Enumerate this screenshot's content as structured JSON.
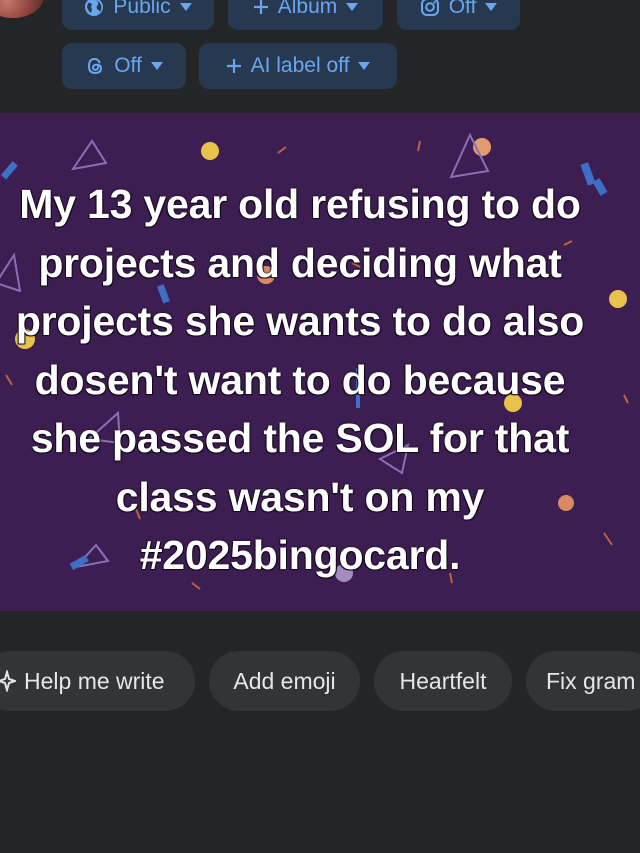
{
  "audience_row": {
    "privacy_label": "Public",
    "album_label": "Album",
    "instagram_label": "Off",
    "threads_label": "Off",
    "ai_label": "AI label off"
  },
  "post": {
    "text": "My 13 year old refusing to do projects and deciding what projects she wants to do also dosen't want to do because she passed the SOL for that class wasn't on my #2025bingocard.",
    "background_color": "#3d1e52"
  },
  "suggestions": [
    {
      "label": "Help me write"
    },
    {
      "label": "Add emoji"
    },
    {
      "label": "Heartfelt"
    },
    {
      "label": "Fix gram"
    }
  ],
  "colors": {
    "pill_background": "#263951",
    "pill_text": "#6aa6f0",
    "chip_background": "#333436",
    "chip_text": "#e4e6eb",
    "page_background": "#242526"
  }
}
